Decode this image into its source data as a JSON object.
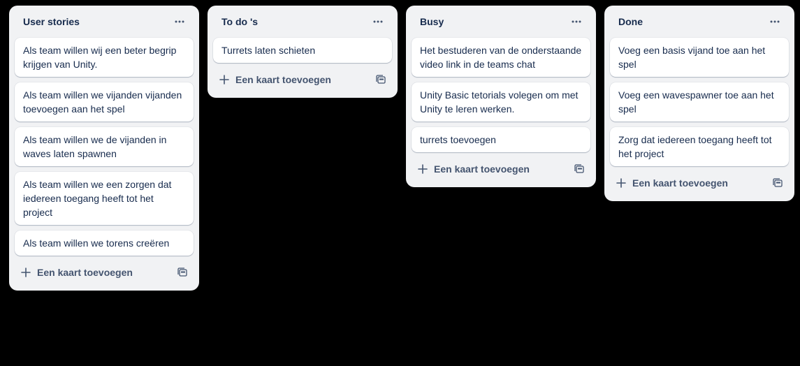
{
  "lists": [
    {
      "title": "User stories",
      "cards": [
        "Als team willen wij een beter begrip krijgen van Unity.",
        "Als team willen we vijanden vijanden toevoegen aan het spel",
        "Als team willen we de vijanden in waves laten spawnen",
        "Als team willen we een zorgen dat iedereen toegang heeft tot het project",
        "Als team willen we torens creëren"
      ],
      "add_label": "Een kaart toevoegen"
    },
    {
      "title": "To do 's",
      "cards": [
        "Turrets laten schieten"
      ],
      "add_label": "Een kaart toevoegen"
    },
    {
      "title": "Busy",
      "cards": [
        "Het bestuderen van de onderstaande video link in de teams chat",
        "Unity Basic tetorials volegen om met Unity te leren werken.",
        "turrets toevoegen"
      ],
      "add_label": "Een kaart toevoegen"
    },
    {
      "title": "Done",
      "cards": [
        "Voeg een basis vijand toe aan het spel",
        "Voeg een wavespawner toe aan het spel",
        "Zorg dat iedereen toegang heeft tot het project"
      ],
      "add_label": "Een kaart toevoegen"
    }
  ],
  "icons": {
    "menu": "more-horizontal-icon",
    "add": "plus-icon",
    "template": "card-template-icon"
  },
  "colors": {
    "board_background": "#000000",
    "list_background": "#f1f2f4",
    "card_background": "#ffffff",
    "text": "#172b4d",
    "muted_text": "#44546f"
  }
}
